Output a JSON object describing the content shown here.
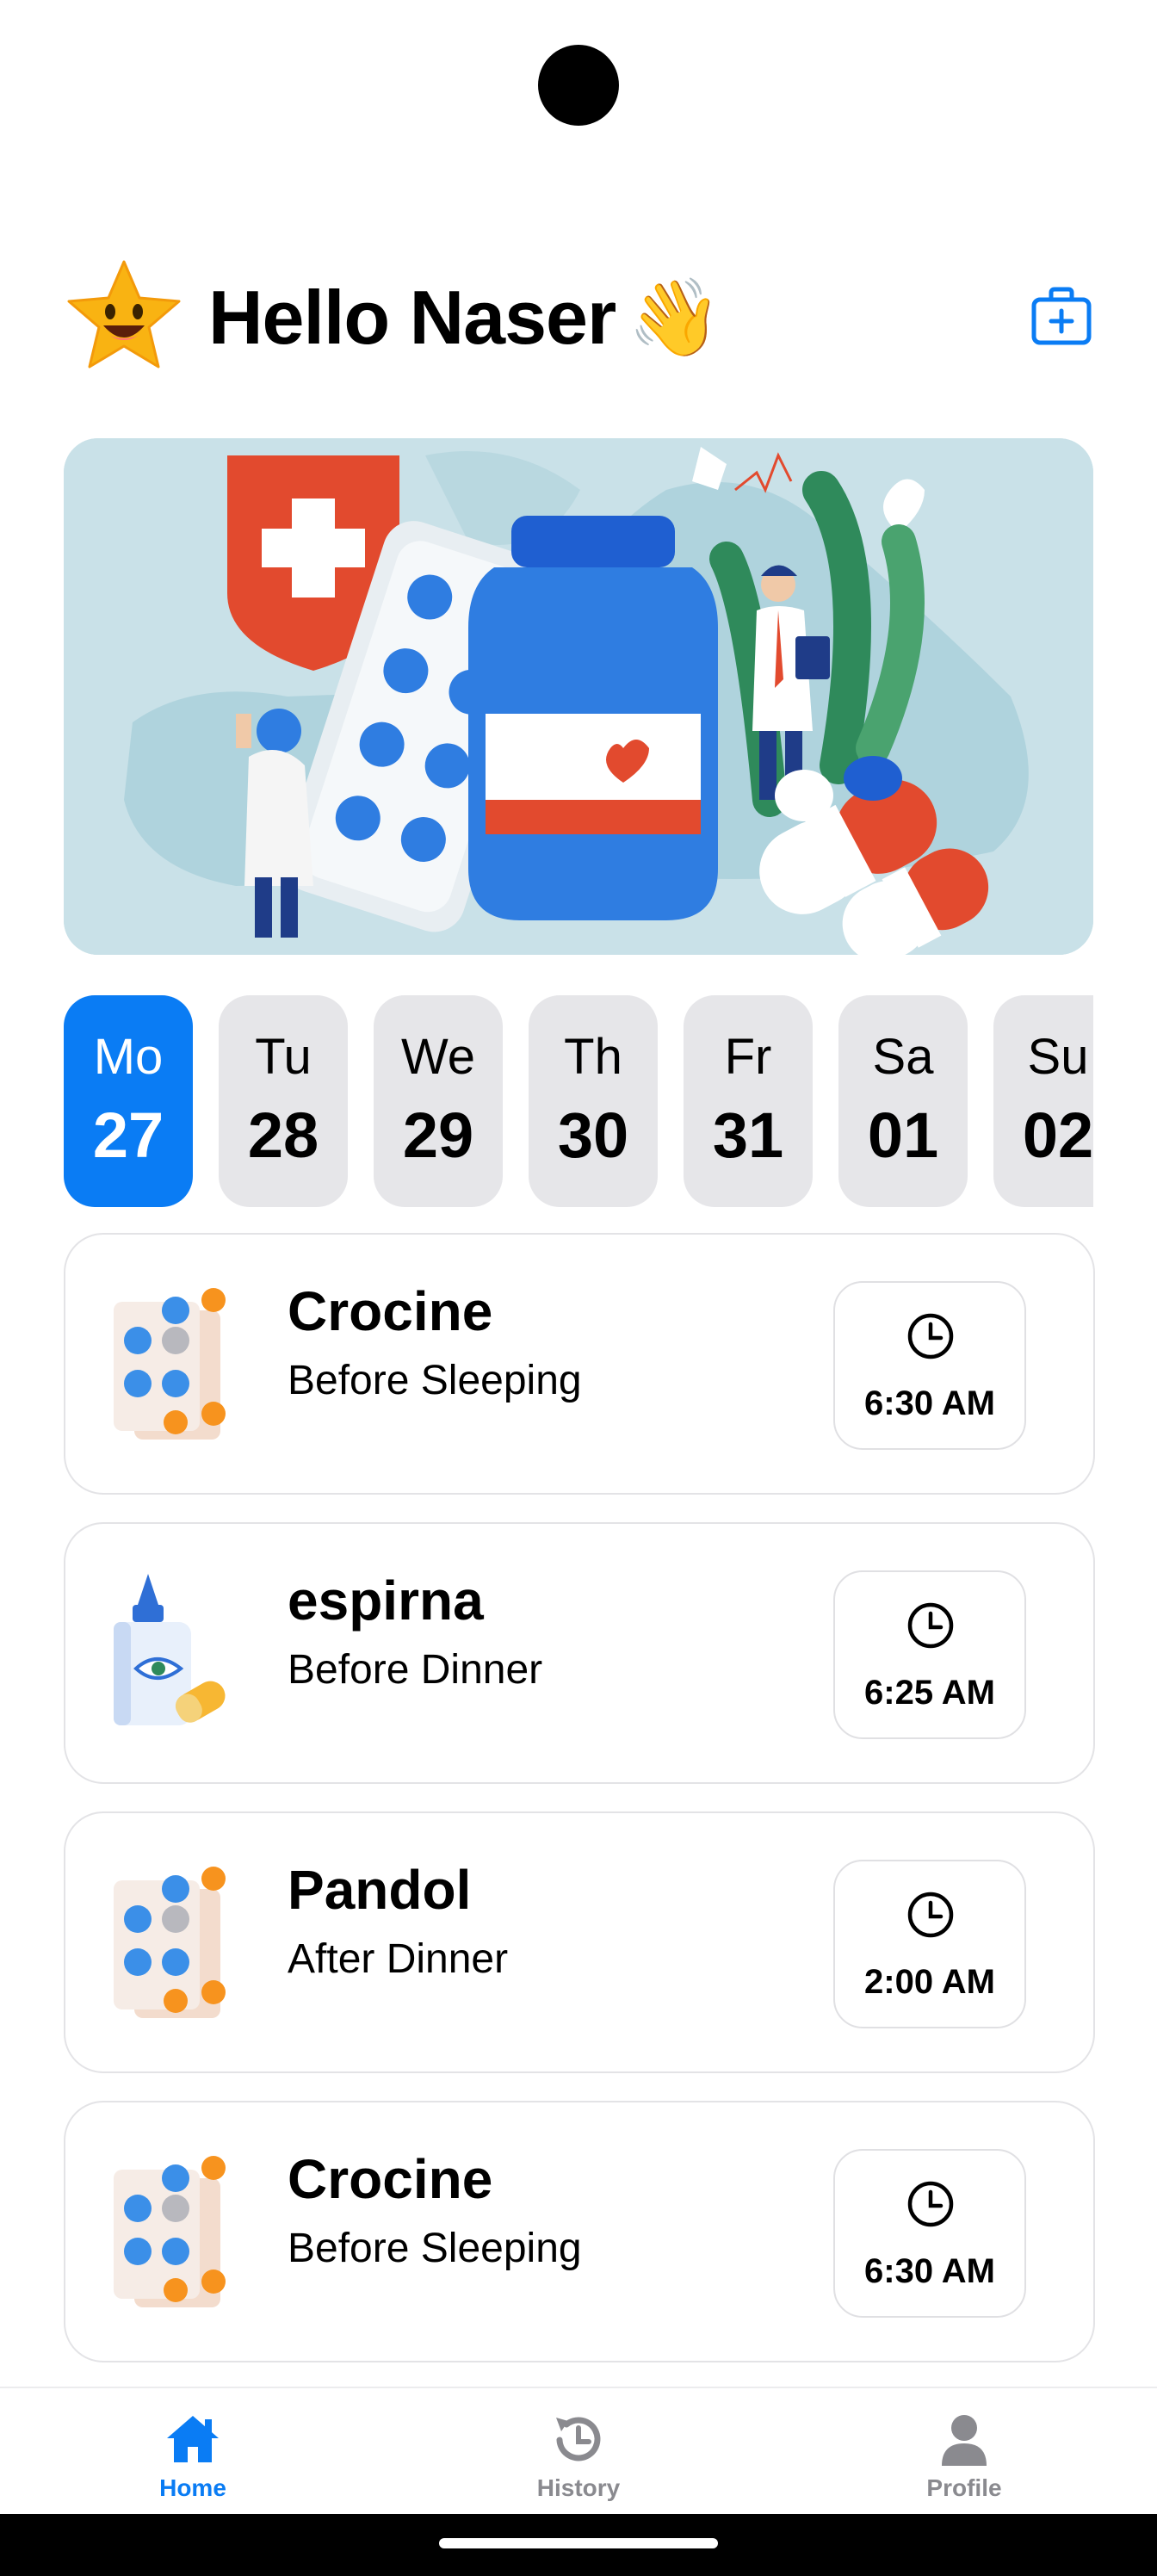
{
  "header": {
    "greeting": "Hello Naser",
    "wave": "👋",
    "add_icon": "medical-kit-plus-icon"
  },
  "colors": {
    "accent": "#0a7cf4",
    "day_inactive": "#e6e6e9",
    "card_border": "#e3e3e6",
    "muted": "#8a8a8f"
  },
  "days": [
    {
      "name": "Mo",
      "num": "27",
      "active": true
    },
    {
      "name": "Tu",
      "num": "28",
      "active": false
    },
    {
      "name": "We",
      "num": "29",
      "active": false
    },
    {
      "name": "Th",
      "num": "30",
      "active": false
    },
    {
      "name": "Fr",
      "num": "31",
      "active": false
    },
    {
      "name": "Sa",
      "num": "01",
      "active": false
    },
    {
      "name": "Su",
      "num": "02",
      "active": false
    }
  ],
  "medicines": [
    {
      "name": "Crocine",
      "note": "Before Sleeping",
      "time": "6:30 AM",
      "icon": "pill-blister-icon"
    },
    {
      "name": "espirna",
      "note": "Before Dinner",
      "time": "6:25 AM",
      "icon": "eye-drops-bottle-icon"
    },
    {
      "name": "Pandol",
      "note": "After Dinner",
      "time": "2:00 AM",
      "icon": "pill-blister-icon"
    },
    {
      "name": "Crocine",
      "note": "Before Sleeping",
      "time": "6:30 AM",
      "icon": "pill-blister-icon"
    }
  ],
  "nav": [
    {
      "label": "Home",
      "icon": "home-icon",
      "active": true
    },
    {
      "label": "History",
      "icon": "history-icon",
      "active": false
    },
    {
      "label": "Profile",
      "icon": "profile-icon",
      "active": false
    }
  ]
}
